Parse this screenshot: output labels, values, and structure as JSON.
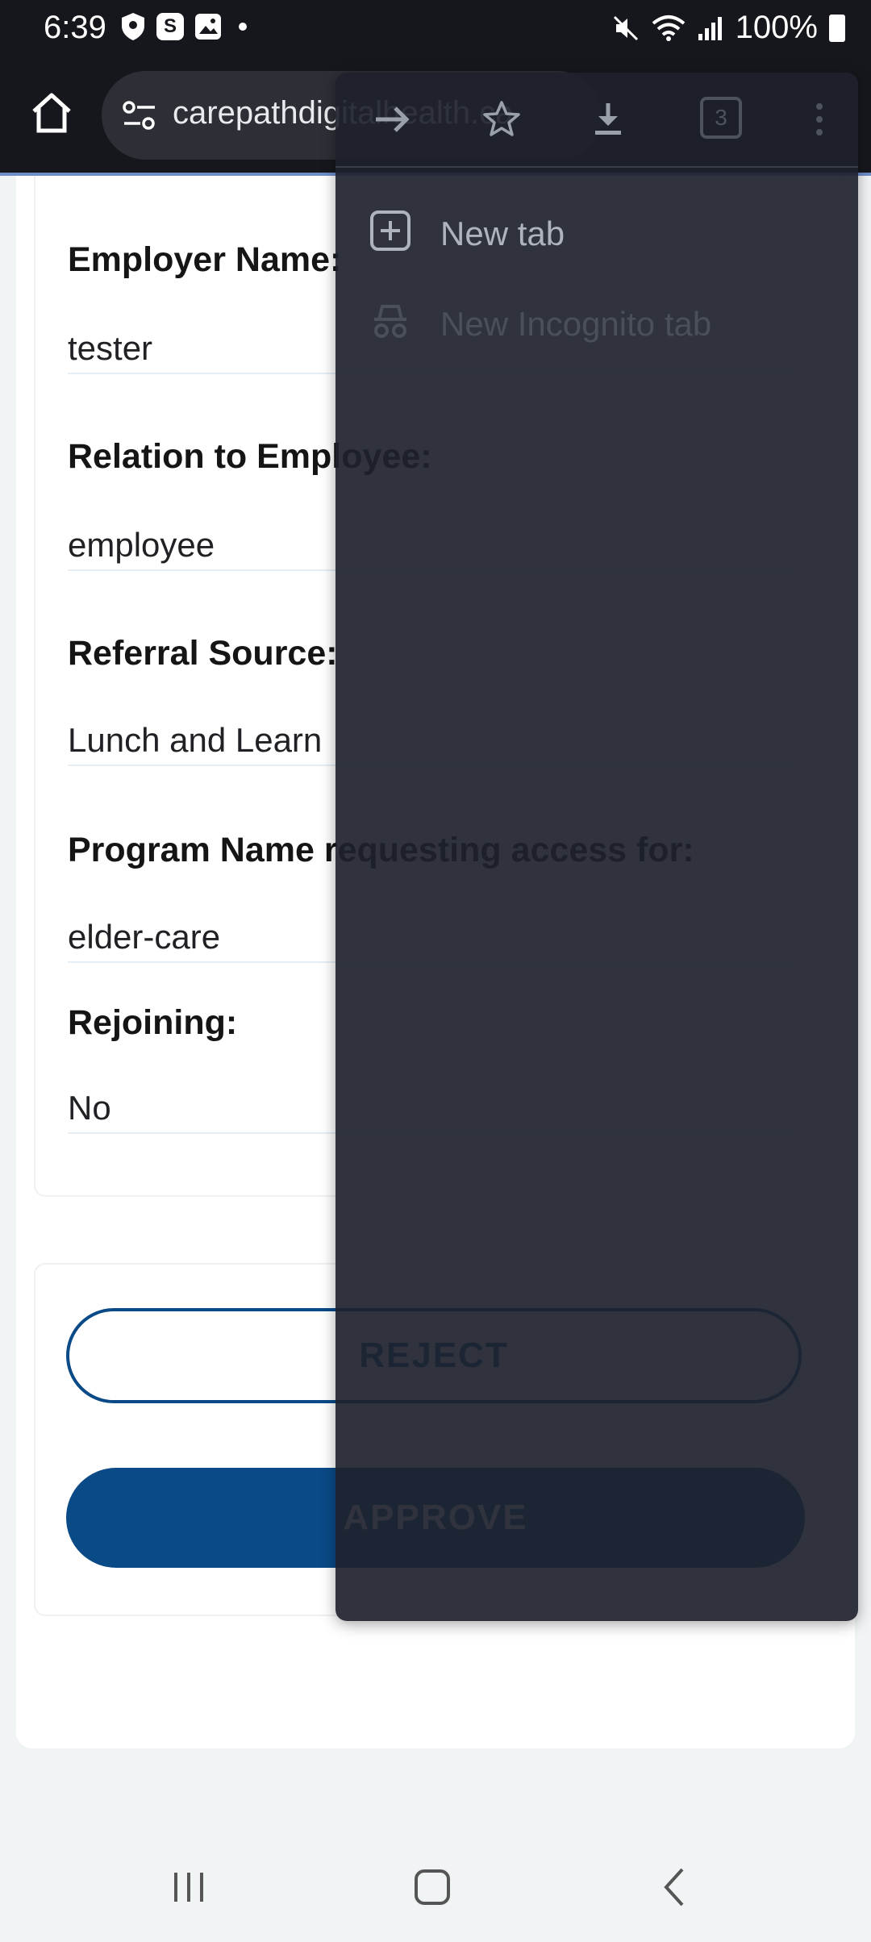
{
  "status_bar": {
    "time": "6:39",
    "app_icon_s": "S",
    "battery": "100%"
  },
  "browser": {
    "url": "carepathdigitalhealth.ca"
  },
  "form": {
    "fields": [
      {
        "label": "Employer Name:",
        "value": "tester"
      },
      {
        "label": "Relation to Employee:",
        "value": "employee"
      },
      {
        "label": "Referral Source:",
        "value": "Lunch and Learn"
      },
      {
        "label": "Program Name requesting access for:",
        "value": "elder-care"
      },
      {
        "label": "Rejoining:",
        "value": "No"
      }
    ]
  },
  "actions": {
    "reject_label": "REJECT",
    "approve_label": "APPROVE"
  },
  "menu": {
    "tab_count": "3",
    "items": [
      {
        "label": "New tab",
        "icon": "new-tab-icon"
      },
      {
        "label": "New Incognito tab",
        "icon": "incognito-icon"
      }
    ]
  },
  "colors": {
    "accent": "#0a4a87",
    "toolbar": "#16171c",
    "menu_bg": "#1e222c"
  }
}
